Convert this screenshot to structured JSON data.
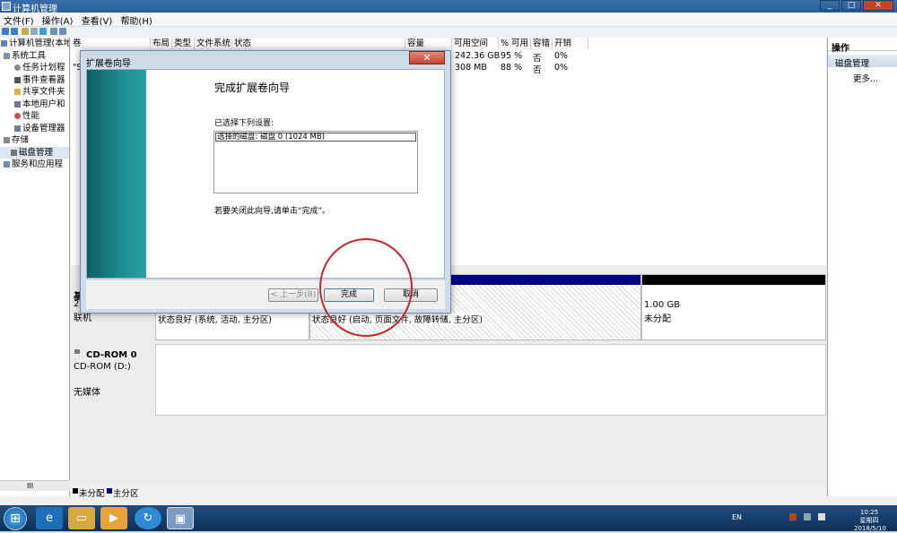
{
  "window": {
    "title": "计算机管理",
    "controls": [
      "_",
      "□",
      "✕"
    ]
  },
  "menu": [
    "文件(F)",
    "操作(A)",
    "查看(V)",
    "帮助(H)"
  ],
  "tree": {
    "items": [
      {
        "label": "计算机管理(本地",
        "level": 0
      },
      {
        "label": "系统工具",
        "level": 1
      },
      {
        "label": "任务计划程",
        "level": 2
      },
      {
        "label": "事件查看器",
        "level": 2
      },
      {
        "label": "共享文件夹",
        "level": 2
      },
      {
        "label": "本地用户和",
        "level": 2
      },
      {
        "label": "性能",
        "level": 2
      },
      {
        "label": "设备管理器",
        "level": 2
      },
      {
        "label": "存储",
        "level": 1
      },
      {
        "label": "磁盘管理",
        "level": 2
      },
      {
        "label": "服务和应用程",
        "level": 1
      }
    ],
    "scroll_label": "III"
  },
  "table": {
    "headers": [
      "卷",
      "布局",
      "类型",
      "文件系统",
      "状态",
      "容量",
      "可用空间",
      "% 可用",
      "容错",
      "开销"
    ],
    "rows": [
      {
        "vol": "",
        "free": "242.36 GB",
        "pct": "95 %",
        "fault": "否",
        "overhead": "0%"
      },
      {
        "vol": "\"S",
        "free": "308 MB",
        "pct": "88 %",
        "fault": "否",
        "overhead": "0%"
      }
    ]
  },
  "disks": {
    "disk0_label": "基",
    "disk0_size": "25",
    "disk0_status": "联机",
    "part1_status": "状态良好 (系统, 活动, 主分区)",
    "part2_status": "状态良好 (启动, 页面文件, 故障转储, 主分区)",
    "unalloc_size": "1.00 GB",
    "unalloc_label": "未分配",
    "cdrom_name": "CD-ROM 0",
    "cdrom_drive": "CD-ROM (D:)",
    "cdrom_status": "无媒体"
  },
  "legend": {
    "unallocated": "未分配",
    "primary": "主分区"
  },
  "actions": {
    "header": "操作",
    "section": "磁盘管理",
    "more": "更多..."
  },
  "wizard": {
    "title": "扩展卷向导",
    "heading": "完成扩展卷向导",
    "settings_label": "已选择下列设置:",
    "selected_item": "选择的磁盘: 磁盘 0 (1024 MB)",
    "hint": "若要关闭此向导,请单击“完成”。",
    "back_button": "< 上一步(B)",
    "finish_button": "完成",
    "cancel_button": "取消",
    "close": "✕"
  },
  "taskbar": {
    "lang": "EN",
    "time": "10:25",
    "weekday": "星期四",
    "date": "2018/5/10"
  },
  "colors": {
    "accent": "#2a5b95",
    "primary_partition": "#000080",
    "annotation_circle": "#c0272d",
    "wizard_side": "#1c8b8e"
  }
}
